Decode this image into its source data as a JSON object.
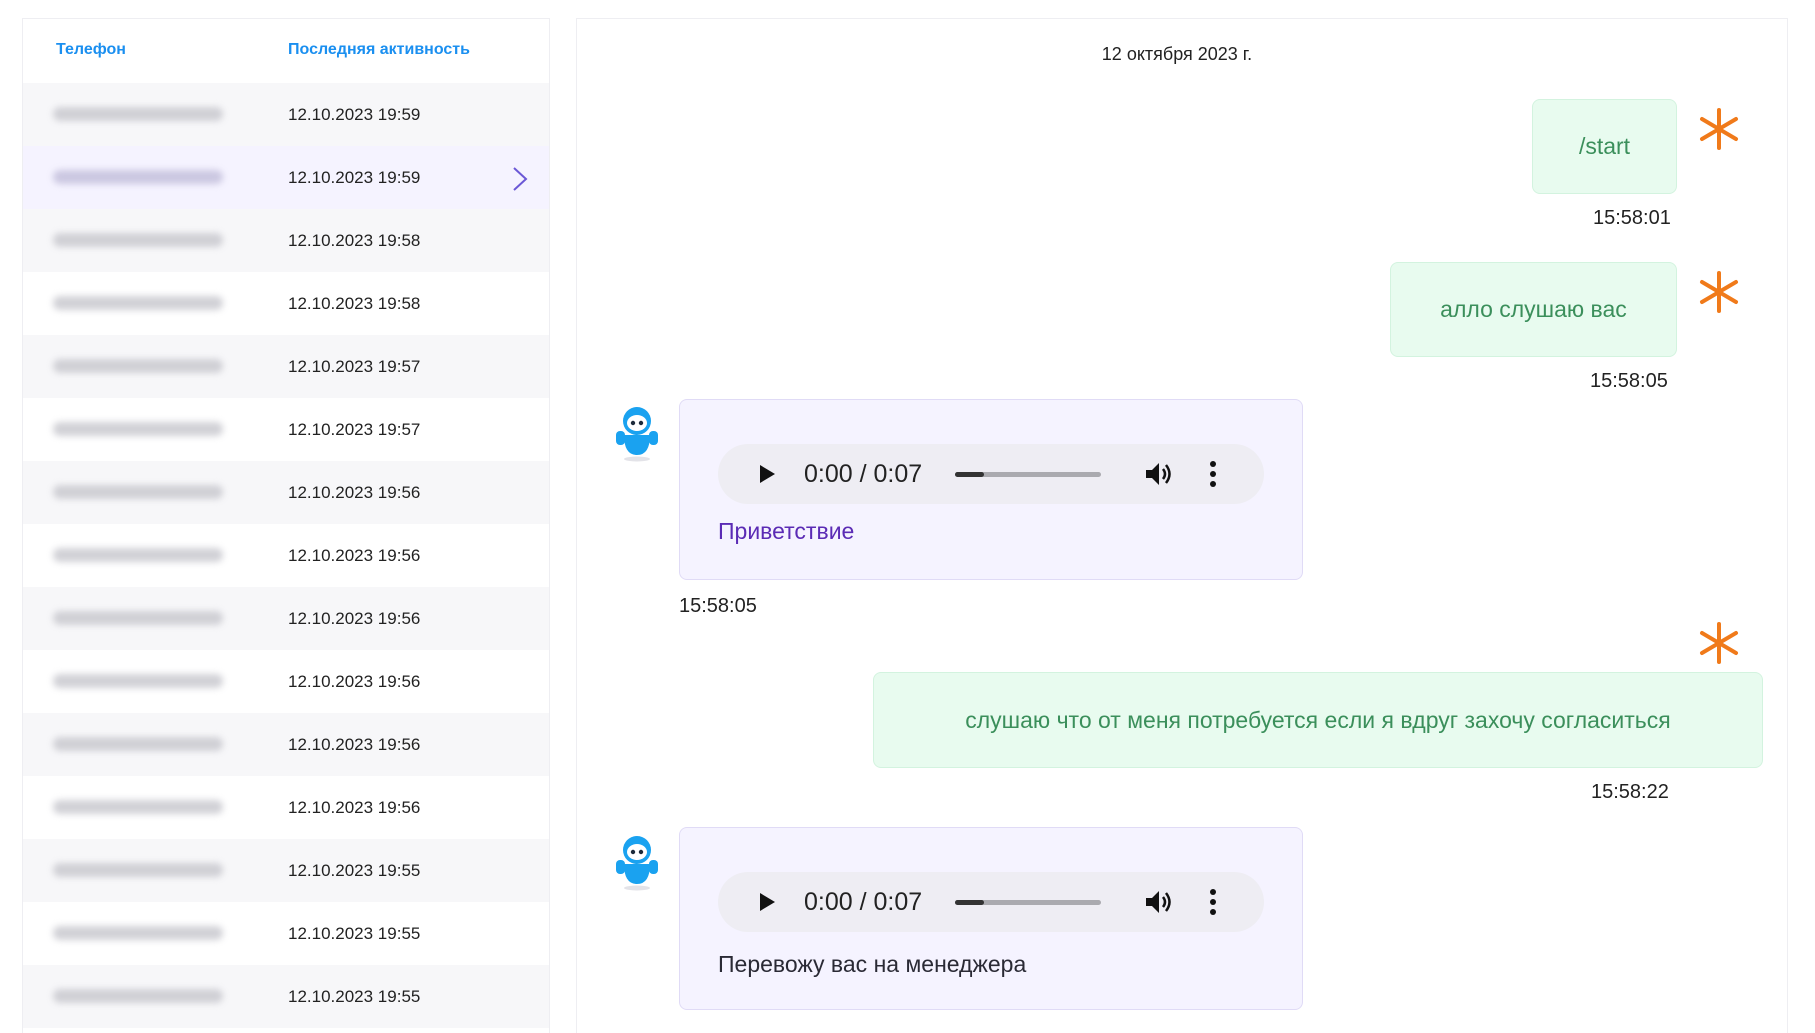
{
  "list": {
    "headers": {
      "phone": "Телефон",
      "last_activity": "Последняя активность"
    },
    "rows": [
      {
        "date": "12.10.2023 19:59"
      },
      {
        "date": "12.10.2023 19:59",
        "selected": true
      },
      {
        "date": "12.10.2023 19:58"
      },
      {
        "date": "12.10.2023 19:58"
      },
      {
        "date": "12.10.2023 19:57"
      },
      {
        "date": "12.10.2023 19:57"
      },
      {
        "date": "12.10.2023 19:56"
      },
      {
        "date": "12.10.2023 19:56"
      },
      {
        "date": "12.10.2023 19:56"
      },
      {
        "date": "12.10.2023 19:56"
      },
      {
        "date": "12.10.2023 19:56"
      },
      {
        "date": "12.10.2023 19:56"
      },
      {
        "date": "12.10.2023 19:55"
      },
      {
        "date": "12.10.2023 19:55"
      },
      {
        "date": "12.10.2023 19:55"
      }
    ]
  },
  "chat": {
    "date_separator": "12 октября 2023 г.",
    "messages": [
      {
        "text": "/start",
        "time": "15:58:01"
      },
      {
        "text": "алло слушаю вас",
        "time": "15:58:05"
      },
      {
        "audio_time": "0:00 / 0:07",
        "audio_progress": 0.2,
        "caption": "Приветствие",
        "time": "15:58:05"
      },
      {
        "text": "слушаю что от меня потребуется если я вдруг захочу согласиться",
        "time": "15:58:22"
      },
      {
        "audio_time": "0:00 / 0:07",
        "audio_progress": 0.2,
        "caption": "Перевожу вас на менеджера"
      }
    ]
  },
  "colors": {
    "accent_blue": "#1a8ff0",
    "user_bubble_bg": "#e8fbef",
    "user_text": "#3b8f5b",
    "bot_bubble_bg": "#f5f3ff",
    "caption_purple": "#5b2bb5",
    "asterisk_orange": "#f07a1a",
    "chevron_purple": "#6b58d6"
  },
  "icons": {
    "row_arrow": "chevron-right-icon",
    "user_marker": "asterisk-icon",
    "bot_avatar": "robot-avatar-icon",
    "audio_play": "play-icon",
    "audio_volume": "volume-icon",
    "audio_menu": "more-vertical-icon"
  }
}
